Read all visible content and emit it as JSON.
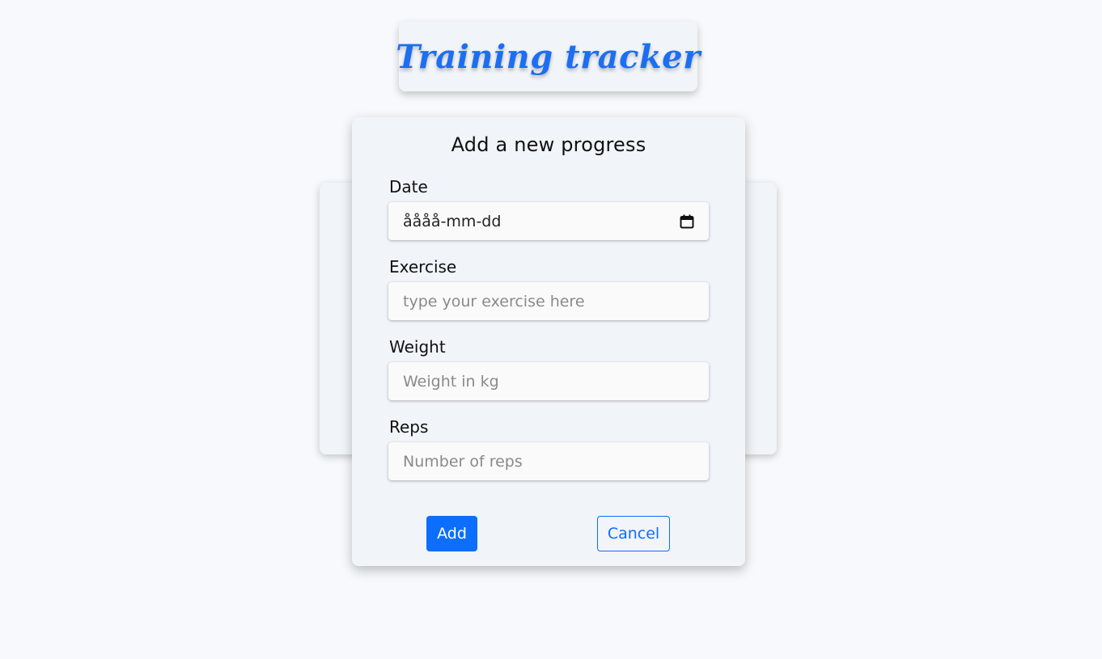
{
  "header": {
    "title": "Training tracker"
  },
  "modal": {
    "title": "Add a new progress",
    "fields": {
      "date": {
        "label": "Date",
        "value": "åååå-mm-dd"
      },
      "exercise": {
        "label": "Exercise",
        "placeholder": "type your exercise here"
      },
      "weight": {
        "label": "Weight",
        "placeholder": "Weight in kg"
      },
      "reps": {
        "label": "Reps",
        "placeholder": "Number of reps"
      }
    },
    "buttons": {
      "add": "Add",
      "cancel": "Cancel"
    }
  },
  "icons": {
    "date_field": "calendar-icon"
  },
  "colors": {
    "accent": "#0d6efd",
    "title": "#1c6ef2",
    "background": "#f8f9fc",
    "card": "#f1f4f8"
  }
}
